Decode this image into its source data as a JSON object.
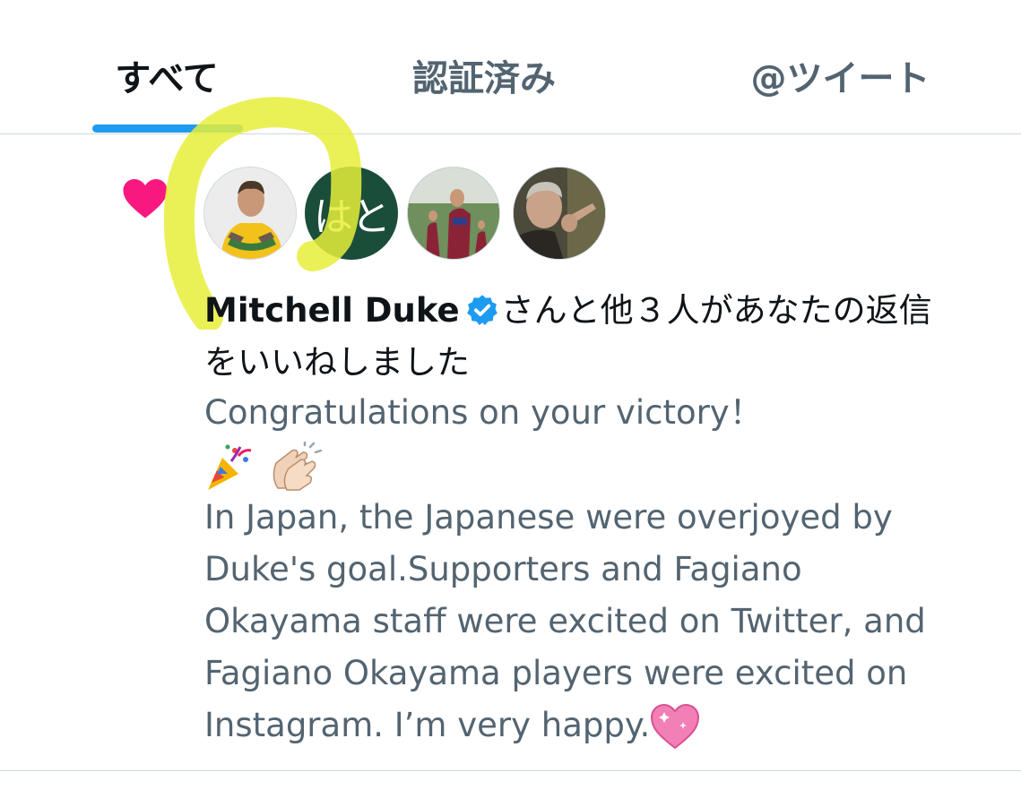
{
  "tabs": [
    {
      "label": "すべて",
      "active": true
    },
    {
      "label": "認証済み",
      "active": false
    },
    {
      "label": "@ツイート",
      "active": false
    }
  ],
  "colors": {
    "accent": "#1d9bf0",
    "heart": "#f91880",
    "highlight": "#e6ee3a",
    "text_primary": "#0f1419",
    "text_secondary": "#536471"
  },
  "notification": {
    "icon": "heart-icon",
    "avatars": [
      {
        "type": "photo",
        "desc": "player-in-yellow-jersey"
      },
      {
        "type": "initials",
        "initials": "はと"
      },
      {
        "type": "photo",
        "desc": "players-on-pitch"
      },
      {
        "type": "photo",
        "desc": "man-pointing"
      }
    ],
    "user_name": "Mitchell Duke",
    "verified": true,
    "action_line1": "さんと他３人があなたの返信",
    "action_line2": "をいいねしました"
  },
  "tweet": {
    "line1": "Congratulations on your victory！",
    "emoji_row": [
      "party-popper-emoji",
      "clapping-hands-emoji"
    ],
    "line2": "In Japan, the Japanese were overjoyed by",
    "line3": "Duke's goal.Supporters and Fagiano",
    "line4": "Okayama staff were excited on Twitter, and",
    "line5": "Fagiano Okayama players were excited on",
    "line6": "Instagram. I’m very happy.",
    "trailing_emoji": "sparkling-heart-emoji"
  }
}
